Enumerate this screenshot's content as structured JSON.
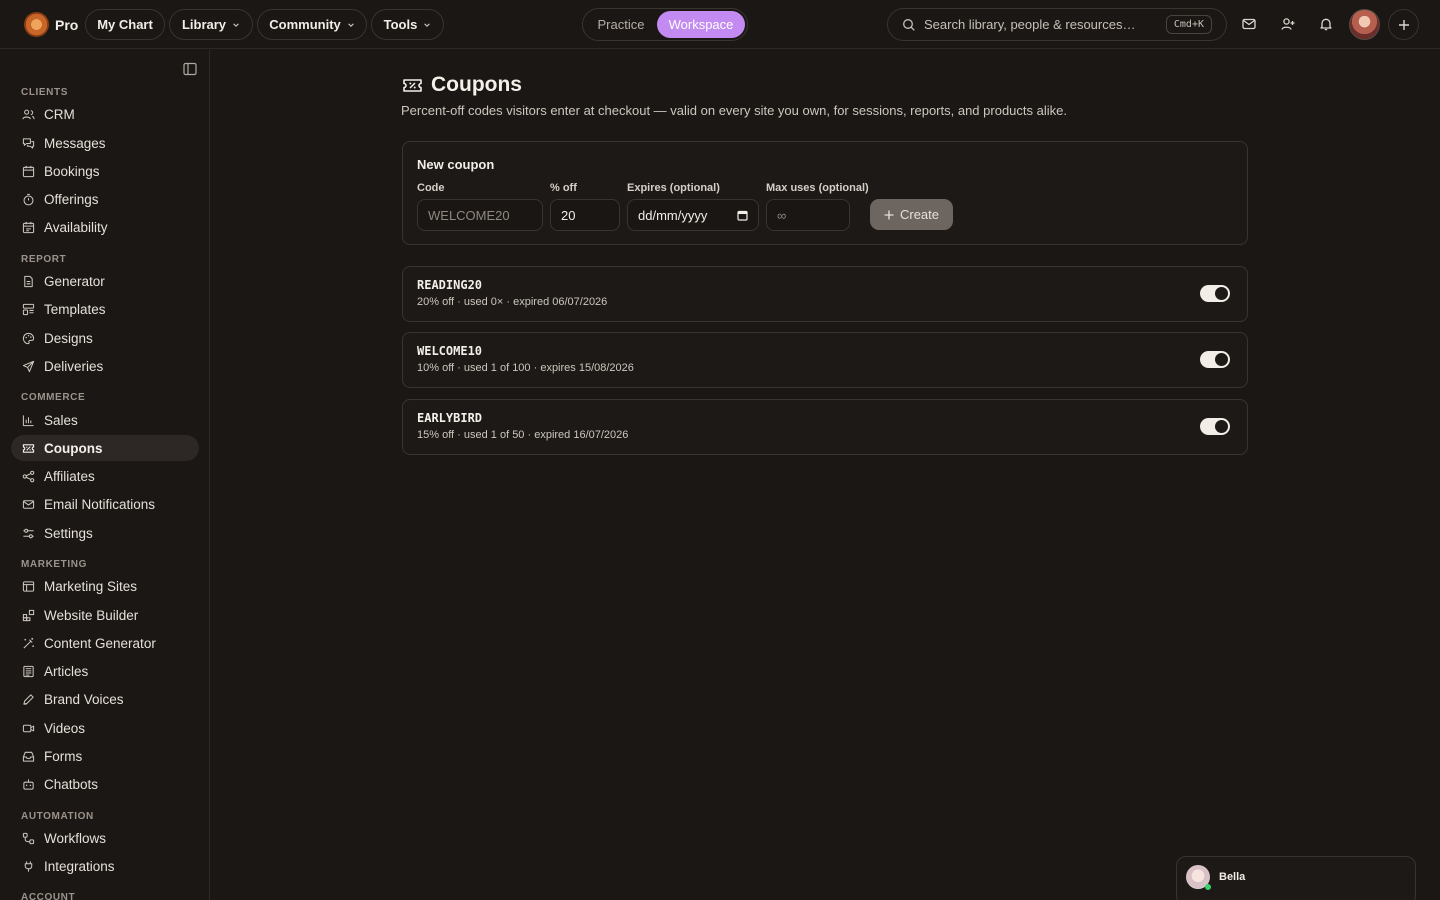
{
  "topbar": {
    "brand": "Pro",
    "nav": [
      {
        "label": "My Chart",
        "has_menu": false
      },
      {
        "label": "Library",
        "has_menu": true
      },
      {
        "label": "Community",
        "has_menu": true
      },
      {
        "label": "Tools",
        "has_menu": true
      }
    ],
    "mode_switch": {
      "options": [
        "Practice",
        "Workspace"
      ],
      "selected": "Workspace"
    },
    "search": {
      "placeholder": "Search library, people & resources…",
      "shortcut": "Cmd+K"
    },
    "icons": [
      "mail-icon",
      "add-person-icon",
      "bell-icon",
      "avatar",
      "plus-icon"
    ]
  },
  "sidebar": {
    "sections": [
      {
        "label": "CLIENTS",
        "items": [
          "CRM",
          "Messages",
          "Bookings",
          "Offerings",
          "Availability"
        ]
      },
      {
        "label": "REPORT",
        "items": [
          "Generator",
          "Templates",
          "Designs",
          "Deliveries"
        ]
      },
      {
        "label": "COMMERCE",
        "items": [
          "Sales",
          "Coupons",
          "Affiliates",
          "Email Notifications",
          "Settings"
        ]
      },
      {
        "label": "MARKETING",
        "items": [
          "Marketing Sites",
          "Website Builder",
          "Content Generator",
          "Articles",
          "Brand Voices",
          "Videos",
          "Forms",
          "Chatbots"
        ]
      },
      {
        "label": "AUTOMATION",
        "items": [
          "Workflows",
          "Integrations"
        ]
      },
      {
        "label": "ACCOUNT",
        "items": []
      }
    ],
    "active": "Coupons"
  },
  "main": {
    "title": "Coupons",
    "description": "Percent-off codes visitors enter at checkout — valid on every site you own, for sessions, reports, and products alike.",
    "new_coupon": {
      "title": "New coupon",
      "fields": {
        "code": {
          "label": "Code",
          "placeholder": "WELCOME20",
          "value": ""
        },
        "percent": {
          "label": "% off",
          "value": "20"
        },
        "expires": {
          "label": "Expires (optional)",
          "value": "dd/mm/yyyy"
        },
        "max_uses": {
          "label": "Max uses (optional)",
          "placeholder": "∞"
        }
      },
      "create_label": "Create"
    },
    "coupons": [
      {
        "code": "READING20",
        "meta": "20% off · used 0× · expired 06/07/2026",
        "enabled": true
      },
      {
        "code": "WELCOME10",
        "meta": "10% off · used 1 of 100 · expires 15/08/2026",
        "enabled": true
      },
      {
        "code": "EARLYBIRD",
        "meta": "15% off · used 1 of 50 · expired 16/07/2026",
        "enabled": true
      }
    ]
  },
  "chat": {
    "name": "Bella"
  },
  "colors": {
    "accent": "#c38bf2",
    "background": "#1b1714",
    "border": "#3a342f",
    "online": "#3ccf6b"
  }
}
